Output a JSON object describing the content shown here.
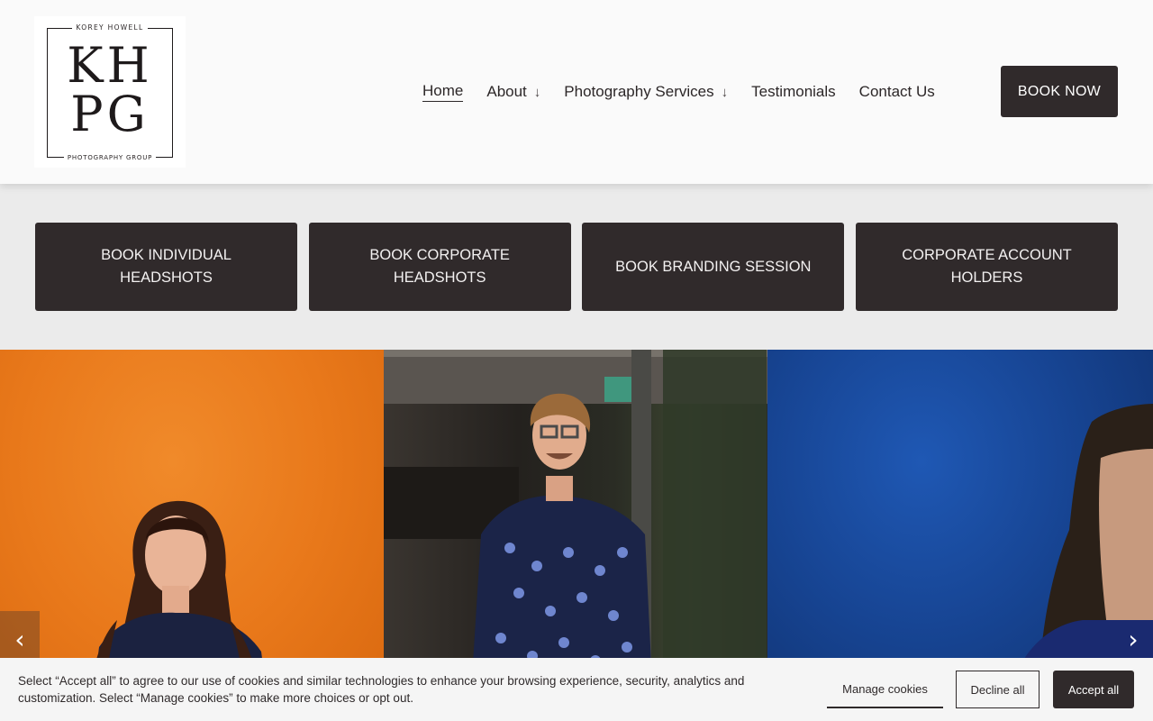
{
  "logo": {
    "top_text": "KOREY HOWELL",
    "monogram_line1": "KH",
    "monogram_line2": "PG",
    "bottom_text": "PHOTOGRAPHY GROUP"
  },
  "nav": {
    "items": [
      {
        "label": "Home",
        "active": true,
        "has_dropdown": false
      },
      {
        "label": "About",
        "active": false,
        "has_dropdown": true
      },
      {
        "label": "Photography Services",
        "active": false,
        "has_dropdown": true
      },
      {
        "label": "Testimonials",
        "active": false,
        "has_dropdown": false
      },
      {
        "label": "Contact Us",
        "active": false,
        "has_dropdown": false
      }
    ],
    "dropdown_icon": "arrow-down-icon",
    "cta_label": "BOOK NOW"
  },
  "actions": [
    {
      "label": "BOOK INDIVIDUAL HEADSHOTS"
    },
    {
      "label": "BOOK CORPORATE HEADSHOTS"
    },
    {
      "label": "BOOK BRANDING SESSION"
    },
    {
      "label": "CORPORATE ACCOUNT HOLDERS"
    }
  ],
  "carousel": {
    "prev_icon": "chevron-left-icon",
    "next_icon": "chevron-right-icon",
    "slides": [
      {
        "subject": "woman-orange-background"
      },
      {
        "subject": "man-polka-dot-shirt"
      },
      {
        "subject": "woman-blue-background"
      }
    ]
  },
  "cookie": {
    "text": "Select “Accept all” to agree to our use of cookies and similar technologies to enhance your browsing experience, security, analytics and customization. Select “Manage cookies” to make more choices or opt out.",
    "manage_label": "Manage cookies",
    "decline_label": "Decline all",
    "accept_label": "Accept all"
  },
  "colors": {
    "brand_dark": "#302a2b",
    "header_bg": "#fafafa",
    "page_bg": "#ebebeb"
  }
}
